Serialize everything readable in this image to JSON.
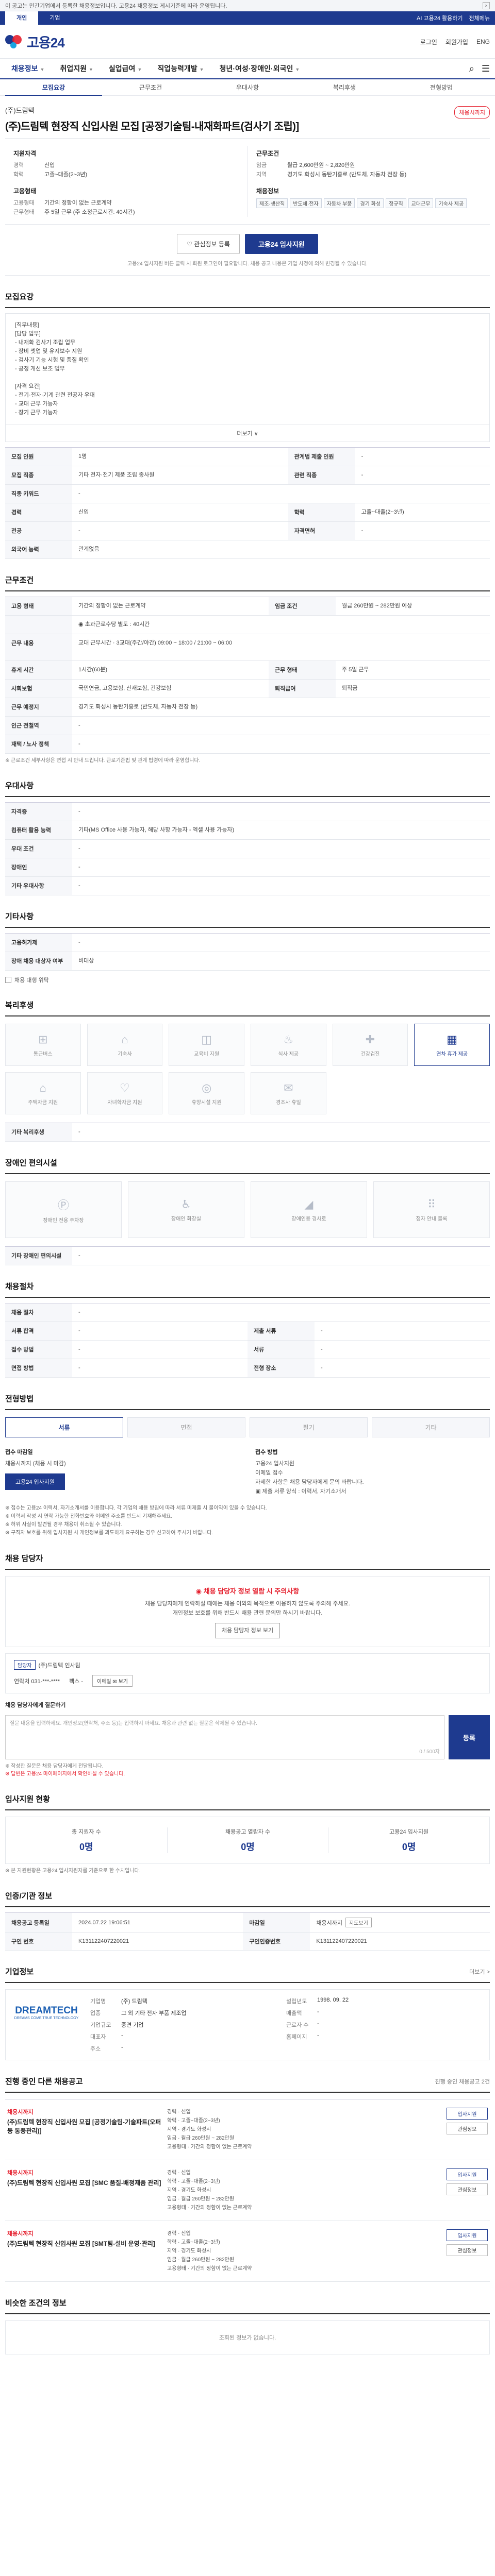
{
  "notice": {
    "text": "이 공고는 민간기업에서 등록한 채용정보입니다. 고용24 채용정보 게시기준에 따라 운영됩니다.",
    "close": "×"
  },
  "util": {
    "tabs": [
      "개인",
      "기업"
    ],
    "right": [
      "AI 고용24 활용하기",
      "전체메뉴"
    ]
  },
  "header": {
    "logo_text": "고용24",
    "right": [
      "로그인",
      "회원가입",
      "ENG"
    ]
  },
  "gnb": {
    "menu": [
      "채용정보",
      "취업지원",
      "실업급여",
      "직업능력개발",
      "청년·여성·장애인·외국인"
    ],
    "icons": [
      "⌕",
      "☰"
    ]
  },
  "subtabs": [
    "모집요강",
    "근무조건",
    "우대사항",
    "복리후생",
    "전형방법"
  ],
  "job": {
    "company": "(주)드림텍",
    "title": "(주)드림텍 현장직 신입사원 모집 [공정기술팀-내재화파트(검사기 조립)]",
    "dday": "채용시까지",
    "summary_left": {
      "heading": "지원자격",
      "rows": [
        {
          "k": "경력",
          "v": "신입"
        },
        {
          "k": "학력",
          "v": "고졸~대졸(2~3년)"
        }
      ],
      "heading2": "고용형태",
      "rows2": [
        {
          "k": "고용형태",
          "v": "기간의 정함이 없는 근로계약"
        },
        {
          "k": "근무형태",
          "v": "주 5일 근무 (주 소정근로시간: 40시간)"
        }
      ]
    },
    "summary_right": {
      "heading": "근무조건",
      "rows": [
        {
          "k": "임금",
          "v": "월급 2,600만원 ~ 2,820만원"
        },
        {
          "k": "지역",
          "v": "경기도 화성시 동탄기흥로 (반도체, 자동차 전장 등)"
        }
      ],
      "heading2": "채용정보",
      "chips": [
        "제조·생산직",
        "반도체·전자",
        "자동차 부품",
        "경기 화성",
        "정규직",
        "교대근무",
        "기숙사 제공"
      ]
    },
    "buttons": {
      "scrap": "♡ 관심정보 등록",
      "apply": "고용24 입사지원"
    },
    "note": "고용24 입사지원 버튼 클릭 시 회원 로그인이 필요합니다. 채용 공고 내용은 기업 사정에 의해 변경될 수 있습니다."
  },
  "recruit": {
    "title": "모집요강",
    "desc": [
      "[직무내용]",
      "",
      "[담당 업무]",
      " - 내재화 검사기 조립 업무",
      " - 장비 셋업 및 유지보수 지원",
      " - 검사기 기능 시험 및 품질 확인",
      " - 공정 개선 보조 업무",
      "",
      "[자격 요건]",
      " - 전기·전자·기계 관련 전공자 우대",
      " - 교대 근무 가능자",
      " - 장기 근무 가능자"
    ],
    "more": "더보기 ∨",
    "rows": [
      {
        "k": "모집 인원",
        "v": "1명",
        "k2": "관계법 제출 인원",
        "v2": "-"
      },
      {
        "k": "모집 직종",
        "v": "기타 전자·전기 제품 조립 종사원",
        "k2": "관련 직종",
        "v2": "-"
      },
      {
        "k": "직종 키워드",
        "v": "-",
        "k2": "",
        "v2": ""
      },
      {
        "k": "경력",
        "v": "신입",
        "k2": "학력",
        "v2": "고졸~대졸(2~3년)"
      },
      {
        "k": "전공",
        "v": "-",
        "k2": "자격면허",
        "v2": "-"
      },
      {
        "k": "외국어 능력",
        "v": "관계없음",
        "k2": "",
        "v2": ""
      }
    ]
  },
  "work": {
    "title": "근무조건",
    "rows": [
      {
        "k": "고용 형태",
        "v": "기간의 정함이 없는 근로계약",
        "k2": "임금 조건",
        "v2": "월급 260만원 ~ 282만원 이상"
      },
      {
        "k": "",
        "v": "◉ 초과근로수당 별도 : 40시간",
        "k2": "",
        "v2": ""
      },
      {
        "k": "근무 내용",
        "v": "교대 근무시간 · 3교대(주간/야간) 09:00 ~ 18:00 / 21:00 ~ 06:00",
        "k2": "",
        "v2": ""
      },
      {
        "k": "휴게 시간",
        "v": "1시간(60분)",
        "k2": "근무 형태",
        "v2": "주 5일 근무"
      },
      {
        "k": "사회보험",
        "v": "국민연금, 고용보험, 산재보험, 건강보험",
        "k2": "퇴직급여",
        "v2": "퇴직금"
      },
      {
        "k": "근무 예정지",
        "v": "경기도 화성시 동탄기흥로 (반도체, 자동차 전장 등)",
        "k2": "",
        "v2": ""
      },
      {
        "k": "인근 전철역",
        "v": "-",
        "k2": "",
        "v2": ""
      },
      {
        "k": "재택 / 노사 정책",
        "v": "-",
        "k2": "",
        "v2": ""
      }
    ],
    "note": "※ 근로조건 세부사항은 면접 시 안내 드립니다. 근로기준법 및 관계 법령에 따라 운영합니다."
  },
  "prefer": {
    "title": "우대사항",
    "rows": [
      {
        "k": "자격증",
        "v": "-"
      },
      {
        "k": "컴퓨터 활용 능력",
        "v": "기타(MS Office 사용 가능자, 해당 사항 가능자 - 엑셀 사용 가능자)"
      },
      {
        "k": "우대 조건",
        "v": "-"
      },
      {
        "k": "장애인",
        "v": "-"
      },
      {
        "k": "기타 우대사항",
        "v": "-"
      }
    ]
  },
  "etc": {
    "title": "기타사항",
    "rows": [
      {
        "k": "고용허가제",
        "v": "-"
      },
      {
        "k": "장애 채용 대상자 여부",
        "v": "비대상"
      }
    ],
    "check": "채용 대행 위탁"
  },
  "welfare": {
    "title": "복리후생",
    "items": [
      {
        "icon": "⊞",
        "label": "통근버스",
        "name": "bus-icon",
        "on": false
      },
      {
        "icon": "⌂",
        "label": "기숙사",
        "name": "dormitory-icon",
        "on": false
      },
      {
        "icon": "◫",
        "label": "교육비 지원",
        "name": "education-icon",
        "on": false
      },
      {
        "icon": "♨",
        "label": "식사 제공",
        "name": "meal-icon",
        "on": false
      },
      {
        "icon": "✚",
        "label": "건강검진",
        "name": "health-icon",
        "on": false
      },
      {
        "icon": "▦",
        "label": "연차 휴가 제공",
        "name": "vacation-icon",
        "on": true
      },
      {
        "icon": "⌂",
        "label": "주택자금 지원",
        "name": "house-icon",
        "on": false
      },
      {
        "icon": "♡",
        "label": "자녀학자금 지원",
        "name": "child-icon",
        "on": false
      },
      {
        "icon": "◎",
        "label": "휴양시설 지원",
        "name": "resort-icon",
        "on": false
      },
      {
        "icon": "✉",
        "label": "경조사 휴일",
        "name": "event-icon",
        "on": false
      }
    ],
    "etc_label": "기타 복리후생",
    "etc_value": "-"
  },
  "disabled": {
    "title": "장애인 편의시설",
    "items": [
      "장애인 전용 주차장",
      "장애인 화장실",
      "장애인용 경사로",
      "점자 안내 블록"
    ],
    "etc_label": "기타 장애인 편의시설",
    "etc_value": "-"
  },
  "selection": {
    "title": "채용절차",
    "rows": [
      {
        "k": "채용 절차",
        "v": "-",
        "k2": "",
        "v2": ""
      },
      {
        "k": "서류 합격",
        "v": "-",
        "k2": "제출 서류",
        "v2": "-"
      },
      {
        "k": "접수 방법",
        "v": "-",
        "k2": "서류",
        "v2": "-"
      },
      {
        "k": "면접 방법",
        "v": "-",
        "k2": "전형 장소",
        "v2": "-"
      }
    ]
  },
  "apply": {
    "title": "전형방법",
    "tabs": [
      "서류",
      "면접",
      "필기",
      "기타"
    ],
    "left_h": "접수 마감일",
    "left_v": "채용시까지 (채용 시 마감)",
    "left_btn": "고용24 입사지원",
    "right_h": "접수 방법",
    "right_lines": [
      "고용24 입사지원",
      "이메일 접수",
      "자세한 사항은 채용 담당자에게 문의 바랍니다.",
      "▣ 제출 서류 양식 : 이력서, 자기소개서"
    ],
    "bullets": [
      "※ 접수는 고용24 이력서, 자기소개서를 이용합니다. 각 기업의 채용 방침에 따라 서류 미제출 시 불이익이 있을 수 있습니다.",
      "※ 이력서 작성 시 연락 가능한 전화번호와 이메일 주소를 반드시 기재해주세요.",
      "※ 허위 사실이 발견될 경우 채용이 취소될 수 있습니다.",
      "※ 구직자 보호를 위해 입사지원 시 개인정보를 과도하게 요구하는 경우 신고하여 주시기 바랍니다."
    ]
  },
  "qna": {
    "title": "채용 담당자",
    "warn_title": "◉ 채용 담당자 정보 열람 시 주의사항",
    "warn_lines": [
      "채용 담당자에게 연락하실 때에는 채용 이외의 목적으로 이용하지 않도록 주의해 주세요.",
      "개인정보 보호를 위해 반드시 채용 관련 문의만 하시기 바랍니다."
    ],
    "warn_btn": "채용 담당자 정보 보기",
    "contact_tag": "담당자",
    "contact_name": "(주)드림텍 인사팀",
    "contact_phone": "연락처 031-***-****",
    "contact_fax": "팩스 -",
    "contact_email": "이메일 ✉ 보기",
    "form_label": "채용 담당자에게 질문하기",
    "form_placeholder": "질문 내용을 입력하세요. 개인정보(연락처, 주소 등)는 입력하지 마세요. 채용과 관련 없는 질문은 삭제될 수 있습니다.",
    "form_count": "0 / 500자",
    "form_send": "등록",
    "notes": [
      "※ 작성한 질문은 채용 담당자에게 전달됩니다.",
      "※ 답변은 고용24 마이페이지에서 확인하실 수 있습니다."
    ]
  },
  "status": {
    "title": "입사지원 현황",
    "items": [
      {
        "label": "총 지원자 수",
        "value": "0명"
      },
      {
        "label": "채용공고 열람자 수",
        "value": "0명"
      },
      {
        "label": "고용24 입사지원",
        "value": "0명"
      }
    ],
    "note": "※ 본 지원현황은 고용24 입사지원자를 기준으로 한 수치입니다."
  },
  "recruit_info": {
    "title": "인증/기관 정보",
    "rows": [
      {
        "k": "채용공고 등록일",
        "v": "2024.07.22 19:06:51",
        "k2": "마감일",
        "v2": "채용시까지"
      },
      {
        "k": "구인 번호",
        "v": "K131122407220021",
        "k2": "구인인증번호",
        "v2": "K131122407220021"
      }
    ],
    "mini": "지도보기"
  },
  "company": {
    "title": "기업정보",
    "link": "더보기 >",
    "logo_main": "DREAMTECH",
    "logo_sub": "DREAMS COME TRUE TECHNOLOGY",
    "rows": [
      [
        "기업명",
        "(주) 드림텍",
        "설립년도",
        "1998. 09. 22"
      ],
      [
        "업종",
        "그 외 기타 전자 부품 제조업",
        "매출액",
        "-"
      ],
      [
        "기업규모",
        "중견 기업",
        "근로자 수",
        "-"
      ],
      [
        "대표자",
        "-",
        "홈페이지",
        "-"
      ],
      [
        "주소",
        "-",
        "",
        ""
      ]
    ]
  },
  "others": {
    "title": "진행 중인 다른 채용공고",
    "sub": "진행 중인 채용공고 2건",
    "items": [
      {
        "co": "채용시까지",
        "title": "(주)드림텍 현장직 신입사원 모집 [공정기술팀-기술파트(오퍼 등 통풍관리)]",
        "l1": "경력 · 신입",
        "l2": "학력 · 고졸~대졸(2~3년)",
        "l3": "지역 · 경기도 화성시",
        "l4": "임금 · 월급 260만원 ~ 282만원",
        "l5": "고용형태 · 기간의 정함이 없는 근로계약"
      },
      {
        "co": "채용시까지",
        "title": "(주)드림텍 현장직 신입사원 모집 [SMC 품질-배정제품 관리]",
        "l1": "경력 · 신입",
        "l2": "학력 · 고졸~대졸(2~3년)",
        "l3": "지역 · 경기도 화성시",
        "l4": "임금 · 월급 260만원 ~ 282만원",
        "l5": "고용형태 · 기간의 정함이 없는 근로계약"
      },
      {
        "co": "채용시까지",
        "title": "(주)드림텍 현장직 신입사원 모집 [SMT팀-설비 운영·관리]",
        "l1": "경력 · 신입",
        "l2": "학력 · 고졸~대졸(2~3년)",
        "l3": "지역 · 경기도 화성시",
        "l4": "임금 · 월급 260만원 ~ 282만원",
        "l5": "고용형태 · 기간의 정함이 없는 근로계약"
      }
    ],
    "btn_apply": "입사지원",
    "btn_scrap": "관심정보"
  },
  "similar": {
    "title": "비슷한 조건의 정보",
    "empty": "조회된 정보가 없습니다."
  }
}
